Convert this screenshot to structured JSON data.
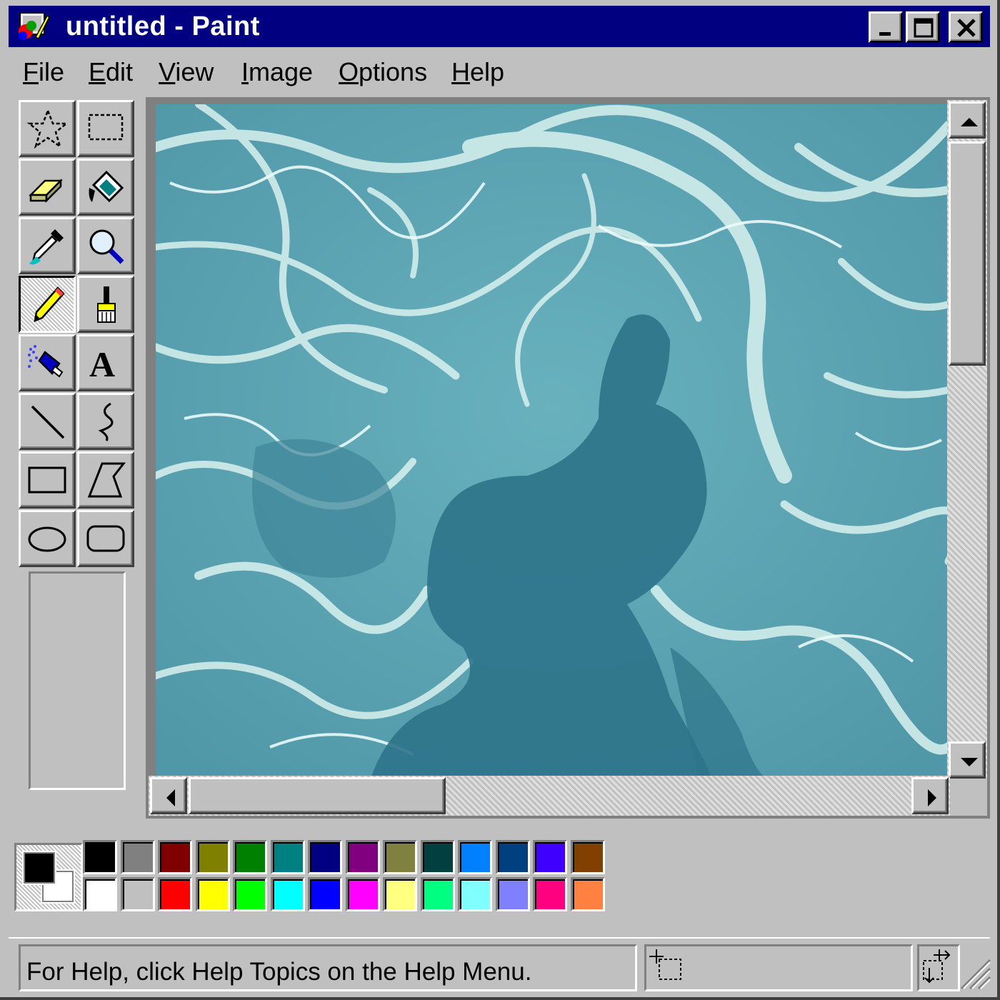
{
  "window": {
    "title": "untitled - Paint",
    "icon": "paint-app-icon",
    "controls": [
      "minimize-icon",
      "maximize-icon",
      "close-icon"
    ]
  },
  "menu": {
    "items": [
      {
        "label": "File",
        "u": "F",
        "rest": "ile"
      },
      {
        "label": "Edit",
        "u": "E",
        "rest": "dit"
      },
      {
        "label": "View",
        "u": "V",
        "rest": "iew"
      },
      {
        "label": "Image",
        "u": "I",
        "rest": "mage"
      },
      {
        "label": "Options",
        "u": "O",
        "rest": "ptions"
      },
      {
        "label": "Help",
        "u": "H",
        "rest": "elp"
      }
    ]
  },
  "tools": [
    {
      "name": "free-form-select",
      "icon": "star-select-icon"
    },
    {
      "name": "select",
      "icon": "rect-select-icon"
    },
    {
      "name": "eraser",
      "icon": "eraser-icon"
    },
    {
      "name": "fill-with-color",
      "icon": "paint-bucket-icon"
    },
    {
      "name": "pick-color",
      "icon": "eyedropper-icon"
    },
    {
      "name": "magnifier",
      "icon": "magnifier-icon"
    },
    {
      "name": "pencil",
      "icon": "pencil-icon",
      "selected": true
    },
    {
      "name": "brush",
      "icon": "brush-icon"
    },
    {
      "name": "airbrush",
      "icon": "airbrush-icon"
    },
    {
      "name": "text",
      "icon": "text-icon",
      "glyph": "A"
    },
    {
      "name": "line",
      "icon": "line-icon"
    },
    {
      "name": "curve",
      "icon": "curve-icon"
    },
    {
      "name": "rectangle",
      "icon": "rectangle-icon"
    },
    {
      "name": "polygon",
      "icon": "polygon-icon"
    },
    {
      "name": "ellipse",
      "icon": "ellipse-icon"
    },
    {
      "name": "rounded-rectangle",
      "icon": "rounded-rectangle-icon"
    }
  ],
  "canvas": {
    "image": "underwater-shadow-photo",
    "colors": {
      "water": "#5aa6b4",
      "caustic": "#d8f2ee",
      "shadow": "#2e7389"
    }
  },
  "palette": {
    "foreground": "#000000",
    "background": "#ffffff",
    "top_row": [
      "#000000",
      "#808080",
      "#800000",
      "#808000",
      "#008000",
      "#008080",
      "#000080",
      "#800080",
      "#808040",
      "#004040",
      "#0080ff",
      "#004080",
      "#4000ff",
      "#804000"
    ],
    "bottom_row": [
      "#ffffff",
      "#c0c0c0",
      "#ff0000",
      "#ffff00",
      "#00ff00",
      "#00ffff",
      "#0000ff",
      "#ff00ff",
      "#ffff80",
      "#00ff80",
      "#80ffff",
      "#8080ff",
      "#ff0080",
      "#ff8040"
    ]
  },
  "status": {
    "help_text": "For Help, click Help Topics on the Help Menu.",
    "position": "",
    "size": ""
  },
  "theme": {
    "face": "#c0c0c0",
    "titlebar": "#000080"
  }
}
